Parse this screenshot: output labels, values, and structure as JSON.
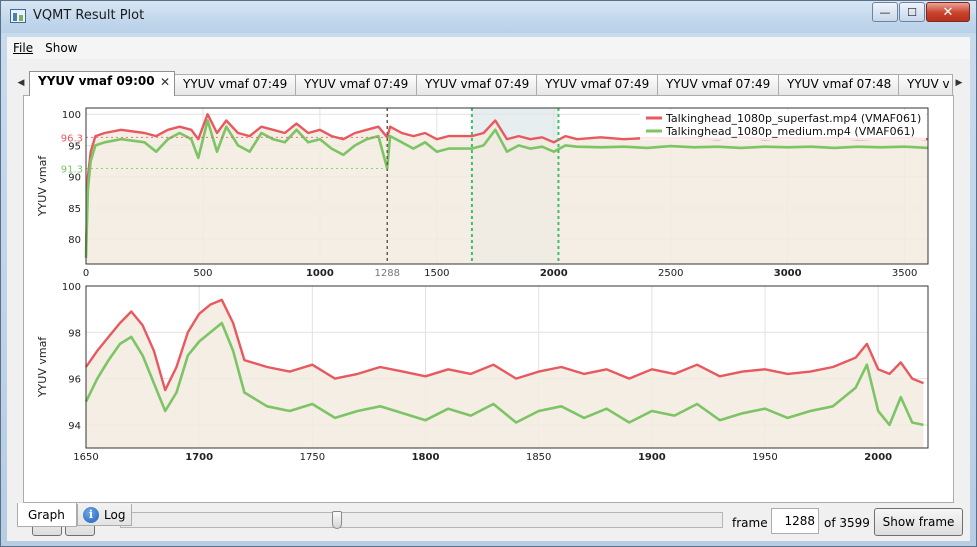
{
  "window": {
    "title": "VQMT Result Plot",
    "caption_buttons": [
      {
        "icon": "minimize-icon",
        "glyph": "—"
      },
      {
        "icon": "maximize-icon",
        "glyph": "☐"
      },
      {
        "icon": "close-icon",
        "glyph": "✕"
      }
    ]
  },
  "menu": [
    {
      "label": "File",
      "accel": "F"
    },
    {
      "label": "Show",
      "accel": "h"
    }
  ],
  "tabs": [
    {
      "label": "YYUV vmaf 09:00",
      "active": true
    },
    {
      "label": "YYUV vmaf 07:49"
    },
    {
      "label": "YYUV vmaf 07:49"
    },
    {
      "label": "YYUV vmaf 07:49"
    },
    {
      "label": "YYUV vmaf 07:49"
    },
    {
      "label": "YYUV vmaf 07:49"
    },
    {
      "label": "YYUV vmaf 07:48"
    },
    {
      "label": "YYUV v"
    }
  ],
  "tab_close_glyph": "✕",
  "tab_scroll_left_glyph": "◀",
  "tab_scroll_right_glyph": "▶",
  "colors": {
    "series_red": "#e8595f",
    "series_green": "#7dc465",
    "marker_dark": "#6b5e4e",
    "marker_green": "#3fbf6a",
    "fill": "#f2ebe1",
    "selection": "#e6eef0"
  },
  "chart_data": [
    {
      "type": "line",
      "title": "",
      "xlabel": "",
      "ylabel": "YYUV vmaf",
      "xlim": [
        0,
        3600
      ],
      "ylim": [
        76,
        101
      ],
      "xticks": [
        0,
        500,
        1000,
        1500,
        2000,
        2500,
        3000,
        3500
      ],
      "yticks": [
        80,
        85,
        90,
        95,
        100
      ],
      "grid": true,
      "legend_position": "top-right",
      "current_frame_marker": {
        "x": 1288,
        "label": "1288"
      },
      "selection_range": [
        1650,
        2020
      ],
      "value_labels": [
        {
          "text": "96.3",
          "series": 0,
          "y": 96.3
        },
        {
          "text": "91.3",
          "series": 1,
          "y": 91.3
        }
      ],
      "series": [
        {
          "name": "Talkinghead_1080p_superfast.mp4 (VMAF061)",
          "x": [
            0,
            8,
            20,
            40,
            80,
            150,
            250,
            300,
            350,
            400,
            450,
            480,
            520,
            560,
            600,
            650,
            700,
            750,
            800,
            850,
            900,
            950,
            1000,
            1050,
            1100,
            1150,
            1200,
            1250,
            1288,
            1300,
            1350,
            1400,
            1450,
            1500,
            1550,
            1600,
            1650,
            1700,
            1750,
            1800,
            1850,
            1900,
            1950,
            2000,
            2050,
            2100,
            2200,
            2300,
            2400,
            2500,
            2600,
            2700,
            2800,
            2900,
            3000,
            3100,
            3200,
            3300,
            3400,
            3500,
            3600
          ],
          "y": [
            78,
            90,
            94,
            96.5,
            97,
            97.5,
            97,
            96.5,
            97.5,
            98,
            97.5,
            96,
            100,
            97,
            99,
            97,
            96.5,
            98,
            97.5,
            97,
            98.5,
            97,
            97.5,
            96.5,
            96,
            97,
            97.5,
            98,
            96.3,
            98,
            97,
            96.5,
            97,
            96,
            96.5,
            96.5,
            96.5,
            97,
            99,
            96,
            96.5,
            96,
            96.3,
            95.5,
            96.5,
            96,
            96.3,
            96,
            96.2,
            96.1,
            96.2,
            96,
            96.3,
            96,
            96.2,
            96.1,
            96.2,
            96,
            96.1,
            96.2,
            96
          ]
        },
        {
          "name": "Talkinghead_1080p_medium.mp4 (VMAF061)",
          "x": [
            0,
            8,
            20,
            40,
            80,
            150,
            250,
            300,
            350,
            400,
            450,
            480,
            520,
            560,
            600,
            650,
            700,
            750,
            800,
            850,
            900,
            950,
            1000,
            1050,
            1100,
            1150,
            1200,
            1250,
            1288,
            1300,
            1350,
            1400,
            1450,
            1500,
            1550,
            1600,
            1650,
            1700,
            1750,
            1800,
            1850,
            1900,
            1950,
            2000,
            2050,
            2100,
            2200,
            2300,
            2400,
            2500,
            2600,
            2700,
            2800,
            2900,
            3000,
            3100,
            3200,
            3300,
            3400,
            3500,
            3600
          ],
          "y": [
            77,
            88,
            92.5,
            95,
            95.5,
            96,
            95.5,
            94,
            96,
            97,
            96,
            93,
            99,
            94,
            98,
            95,
            94,
            97,
            96,
            95.5,
            97.5,
            95.5,
            96,
            94.5,
            93.5,
            95,
            96,
            96.5,
            91.3,
            96.5,
            95.5,
            94.5,
            95.5,
            94,
            94.5,
            94.5,
            94.5,
            95,
            97.5,
            94,
            95,
            94.5,
            94.8,
            94,
            95,
            94.8,
            94.7,
            94.8,
            94.6,
            94.9,
            94.7,
            94.8,
            94.6,
            94.8,
            94.7,
            94.8,
            94.6,
            94.8,
            94.7,
            94.8,
            94.6
          ]
        }
      ]
    },
    {
      "type": "line",
      "title": "",
      "xlabel": "",
      "ylabel": "YYUV vmaf",
      "xlim": [
        1650,
        2022
      ],
      "ylim": [
        93,
        100
      ],
      "xticks": [
        1650,
        1700,
        1750,
        1800,
        1850,
        1900,
        1950,
        2000
      ],
      "yticks": [
        94,
        96,
        98,
        100
      ],
      "grid": true,
      "series": [
        {
          "name": "Talkinghead_1080p_superfast.mp4 (VMAF061)",
          "x": [
            1650,
            1655,
            1660,
            1665,
            1670,
            1675,
            1680,
            1685,
            1690,
            1695,
            1700,
            1705,
            1710,
            1715,
            1720,
            1730,
            1740,
            1750,
            1760,
            1770,
            1780,
            1790,
            1800,
            1810,
            1820,
            1830,
            1840,
            1850,
            1860,
            1870,
            1880,
            1890,
            1900,
            1910,
            1920,
            1930,
            1940,
            1950,
            1960,
            1970,
            1980,
            1990,
            1995,
            2000,
            2005,
            2010,
            2015,
            2020
          ],
          "y": [
            96.5,
            97.2,
            97.8,
            98.4,
            98.9,
            98.3,
            97.2,
            95.5,
            96.5,
            98.0,
            98.8,
            99.2,
            99.4,
            98.4,
            96.8,
            96.5,
            96.3,
            96.6,
            96.0,
            96.2,
            96.5,
            96.3,
            96.1,
            96.4,
            96.2,
            96.6,
            96.0,
            96.3,
            96.5,
            96.2,
            96.4,
            96.0,
            96.4,
            96.2,
            96.6,
            96.1,
            96.3,
            96.4,
            96.2,
            96.3,
            96.5,
            96.9,
            97.5,
            96.4,
            96.2,
            96.7,
            96.0,
            95.8
          ]
        },
        {
          "name": "Talkinghead_1080p_medium.mp4 (VMAF061)",
          "x": [
            1650,
            1655,
            1660,
            1665,
            1670,
            1675,
            1680,
            1685,
            1690,
            1695,
            1700,
            1705,
            1710,
            1715,
            1720,
            1730,
            1740,
            1750,
            1760,
            1770,
            1780,
            1790,
            1800,
            1810,
            1820,
            1830,
            1840,
            1850,
            1860,
            1870,
            1880,
            1890,
            1900,
            1910,
            1920,
            1930,
            1940,
            1950,
            1960,
            1970,
            1980,
            1990,
            1995,
            2000,
            2005,
            2010,
            2015,
            2020
          ],
          "y": [
            95.0,
            96.0,
            96.8,
            97.5,
            97.8,
            97.0,
            95.8,
            94.6,
            95.4,
            97.0,
            97.6,
            98.0,
            98.4,
            97.2,
            95.4,
            94.8,
            94.6,
            94.9,
            94.3,
            94.6,
            94.8,
            94.5,
            94.2,
            94.7,
            94.4,
            94.9,
            94.1,
            94.6,
            94.8,
            94.3,
            94.7,
            94.1,
            94.6,
            94.4,
            94.9,
            94.2,
            94.5,
            94.7,
            94.3,
            94.6,
            94.8,
            95.6,
            96.6,
            94.6,
            94.0,
            95.2,
            94.1,
            94.0
          ]
        }
      ]
    }
  ],
  "controls": {
    "prev_label": "<",
    "next_label": ">",
    "slider_fraction": 0.358,
    "frame_label": "frame",
    "frame_value": "1288",
    "of_label": "of 3599",
    "show_frame_label": "Show frame"
  },
  "bottom_tabs": [
    {
      "label": "Graph",
      "active": true
    },
    {
      "label": "Log",
      "icon": "info-icon",
      "glyph": "i"
    }
  ]
}
